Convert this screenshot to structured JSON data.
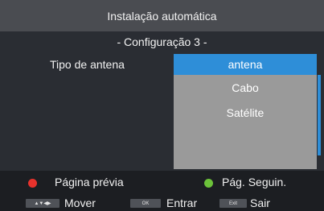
{
  "header": {
    "title": "Instalação automática"
  },
  "step": {
    "subtitle": "- Configuração 3 -"
  },
  "form": {
    "antenna_type_label": "Tipo de antena"
  },
  "options": {
    "selected_index": 0,
    "items": [
      {
        "label": "antena"
      },
      {
        "label": "Cabo"
      },
      {
        "label": "Satélite"
      }
    ]
  },
  "footer": {
    "prev_page": {
      "label": "Página prévia",
      "color": "#e8322c"
    },
    "next_page": {
      "label": "Pág. Seguin.",
      "color": "#6cc23a"
    },
    "move": {
      "key": "▲▼◀▶",
      "label": "Mover"
    },
    "enter": {
      "key": "OK",
      "label": "Entrar"
    },
    "exit": {
      "key": "Exit",
      "label": "Sair"
    }
  },
  "colors": {
    "selection": "#2e8ed8",
    "list_background": "#9a9a9a"
  }
}
